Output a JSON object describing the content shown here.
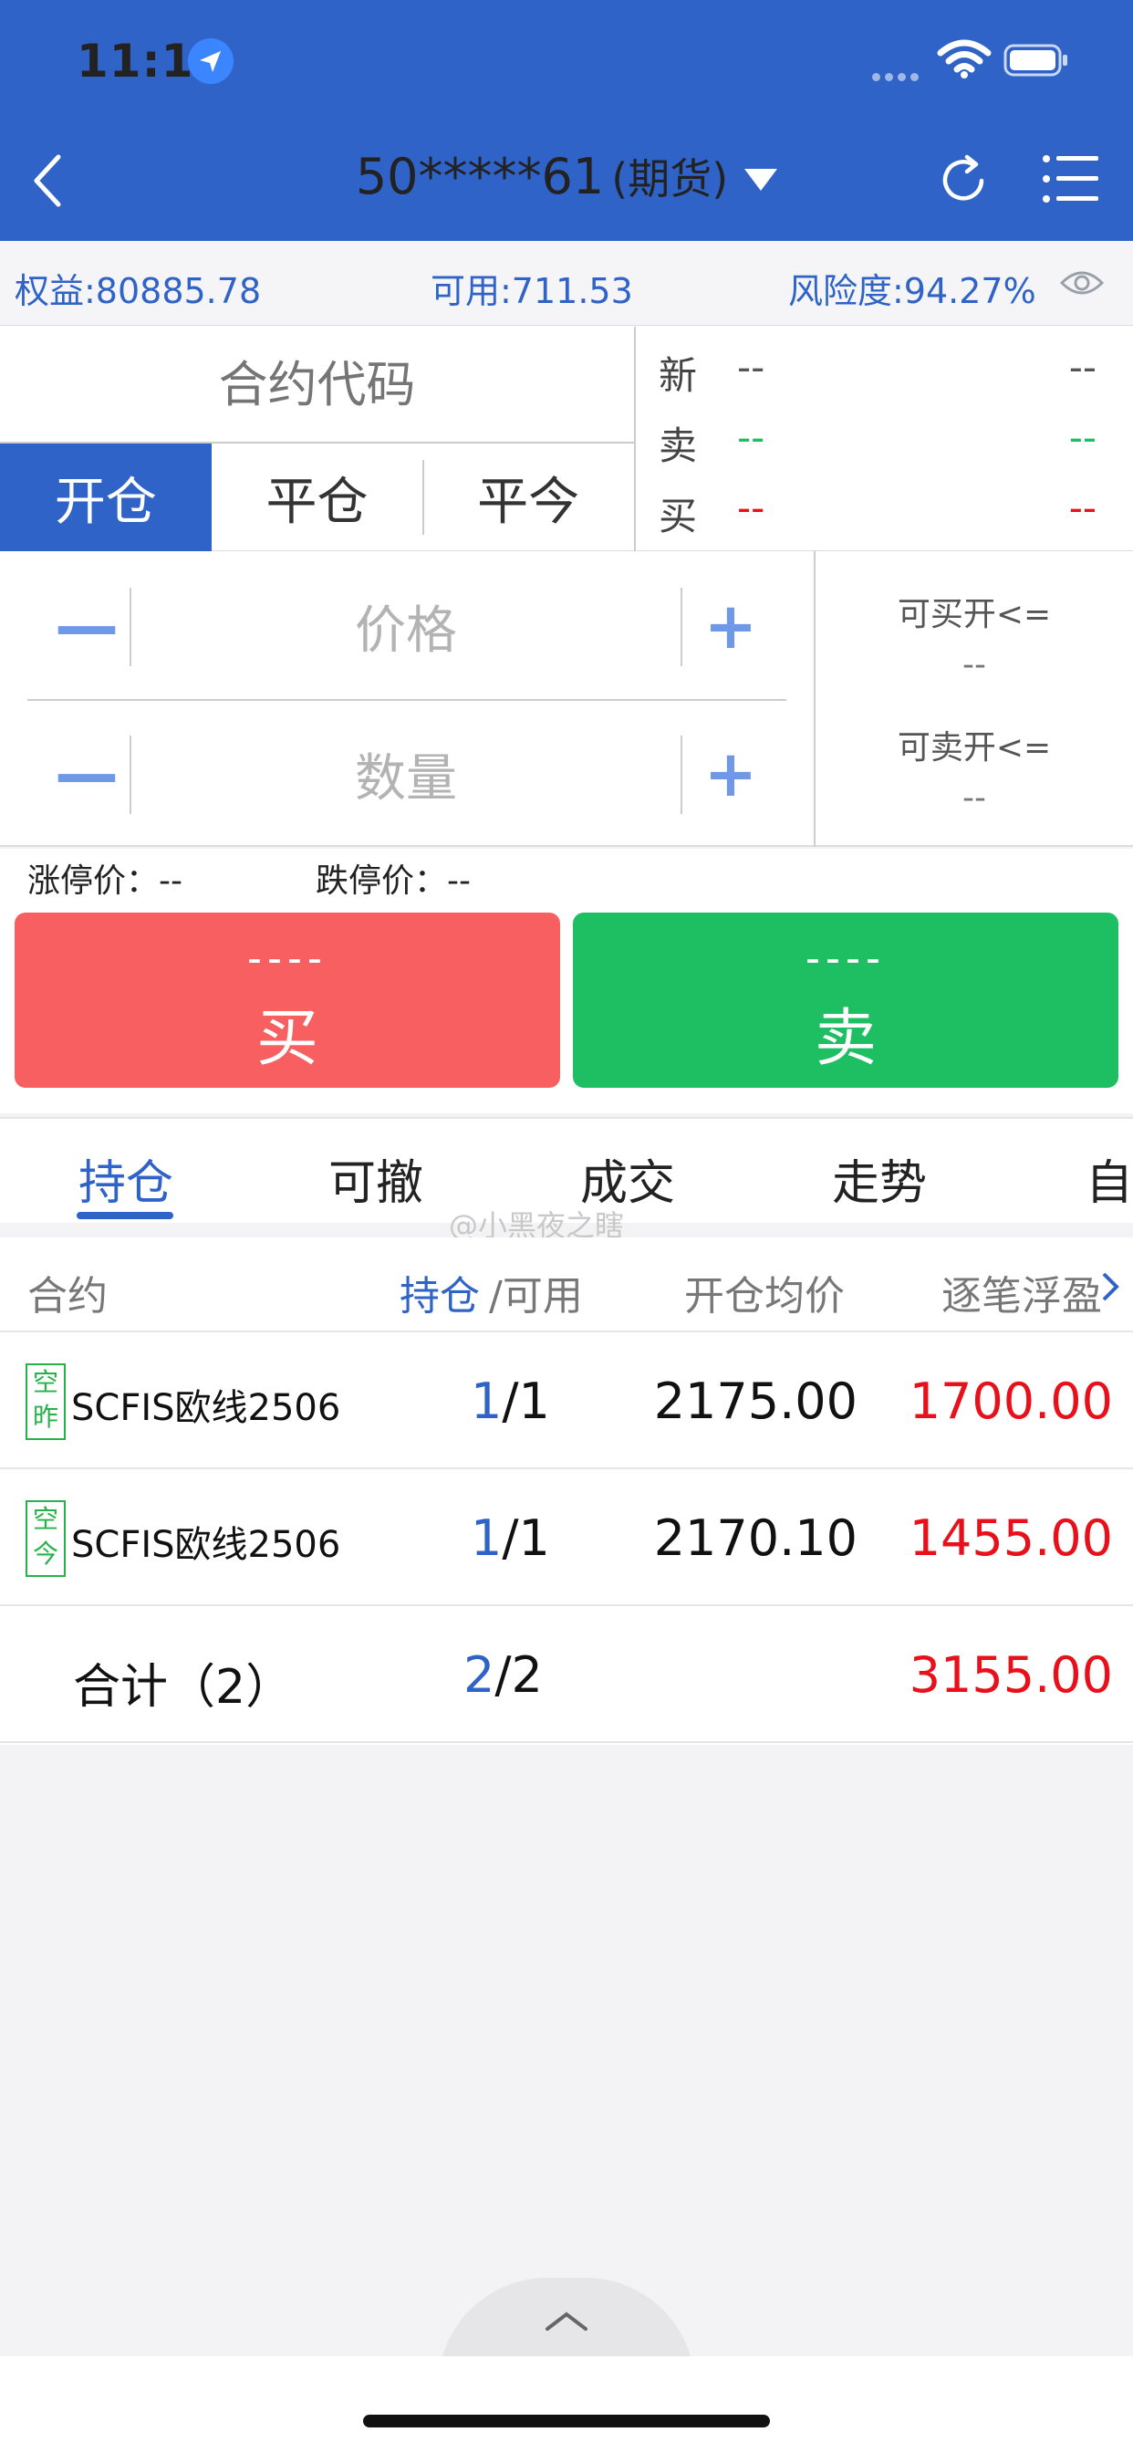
{
  "status_bar": {
    "time": "11:19"
  },
  "header": {
    "account": "50*****61",
    "account_type": "(期货)"
  },
  "summary": {
    "equity": "权益:80885.78",
    "available": "可用:711.53",
    "risk": "风险度:94.27%"
  },
  "order": {
    "contract_placeholder": "合约代码",
    "mode_tabs": [
      "开仓",
      "平仓",
      "平今"
    ],
    "quote": [
      {
        "label": "新",
        "v1": "--",
        "v2": "--"
      },
      {
        "label": "卖",
        "v1": "--",
        "v2": "--"
      },
      {
        "label": "买",
        "v1": "--",
        "v2": "--"
      }
    ],
    "minus": "—",
    "plus": "+",
    "price_placeholder": "价格",
    "qty_placeholder": "数量",
    "avail_buy_label": "可买开<=",
    "avail_buy_value": "--",
    "avail_sell_label": "可卖开<=",
    "avail_sell_value": "--",
    "limit_up": "涨停价：--",
    "limit_down": "跌停价：--",
    "buy": {
      "dash": "----",
      "label": "买"
    },
    "sell": {
      "dash": "----",
      "label": "卖"
    }
  },
  "tabs": [
    "持仓",
    "可撤",
    "成交",
    "走势",
    "自"
  ],
  "watermark": "@小黑夜之瞎",
  "table": {
    "headers": {
      "contract": "合约",
      "hold": "持仓",
      "slash_avail": "/可用",
      "avg_price": "开仓均价",
      "float_pnl": "逐笔浮盈"
    },
    "rows": [
      {
        "tag": "空昨",
        "tag_top": "空",
        "tag_bottom": "昨",
        "name": "SCFIS欧线2506",
        "hold": "1",
        "avail": "/1",
        "avg": "2175.00",
        "pnl": "1700.00"
      },
      {
        "tag": "空今",
        "tag_top": "空",
        "tag_bottom": "今",
        "name": "SCFIS欧线2506",
        "hold": "1",
        "avail": "/1",
        "avg": "2170.10",
        "pnl": "1455.00"
      }
    ],
    "total": {
      "name": "合计（2）",
      "hold": "2",
      "avail": "/2",
      "pnl": "3155.00"
    }
  },
  "colors": {
    "brand": "#2f63c8",
    "buy": "#f85f60",
    "sell": "#1ebf63",
    "profit": "#e8101a",
    "tag": "#28b04b"
  }
}
